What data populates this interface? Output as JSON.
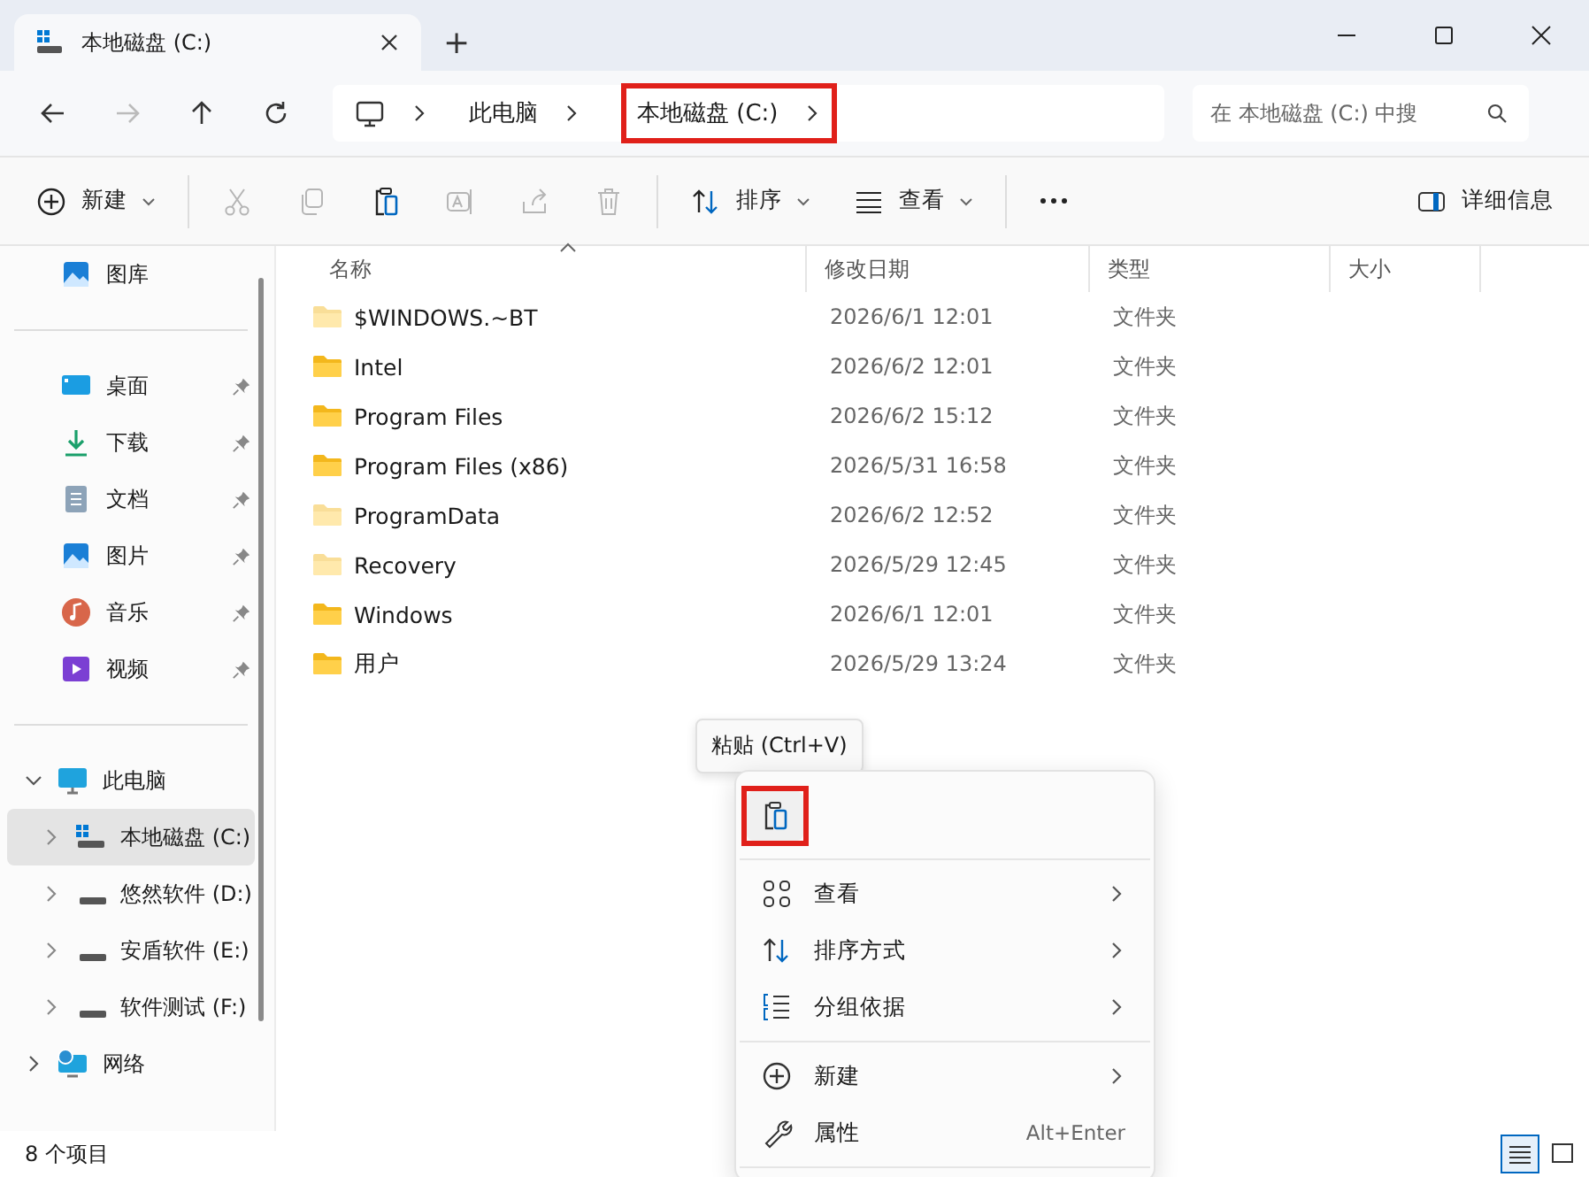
{
  "window": {
    "tab_title": "本地磁盘 (C:)",
    "new_tab": "+"
  },
  "address_bar": {
    "breadcrumbs": [
      {
        "label": "此电脑",
        "highlighted": false
      },
      {
        "label": "本地磁盘 (C:)",
        "highlighted": true
      }
    ]
  },
  "search": {
    "placeholder": "在 本地磁盘 (C:) 中搜"
  },
  "toolbar": {
    "buttons": [
      {
        "kind": "new",
        "label": "新建",
        "dropdown": true,
        "disabled": false
      },
      {
        "kind": "cut",
        "disabled": true
      },
      {
        "kind": "copy",
        "disabled": true
      },
      {
        "kind": "paste",
        "disabled": false
      },
      {
        "kind": "rename",
        "disabled": true
      },
      {
        "kind": "share",
        "disabled": true
      },
      {
        "kind": "delete",
        "disabled": true
      },
      {
        "kind": "sort",
        "label": "排序",
        "dropdown": true,
        "disabled": false
      },
      {
        "kind": "view",
        "label": "查看",
        "dropdown": true,
        "disabled": false
      },
      {
        "kind": "more",
        "disabled": false
      }
    ],
    "details": {
      "label": "详细信息"
    }
  },
  "sidebar": {
    "quick_access": [
      {
        "kind": "gallery",
        "label": "图库",
        "pinned": false
      },
      {
        "kind": "desktop",
        "label": "桌面",
        "pinned": true
      },
      {
        "kind": "download",
        "label": "下载",
        "pinned": true
      },
      {
        "kind": "document",
        "label": "文档",
        "pinned": true
      },
      {
        "kind": "picture",
        "label": "图片",
        "pinned": true
      },
      {
        "kind": "music",
        "label": "音乐",
        "pinned": true
      },
      {
        "kind": "video",
        "label": "视频",
        "pinned": true
      }
    ],
    "tree": [
      {
        "kind": "pc",
        "label": "此电脑",
        "expanded": true,
        "selected": false,
        "children": [
          {
            "kind": "system-drive",
            "label": "本地磁盘 (C:)",
            "expanded": false,
            "selected": true
          },
          {
            "kind": "drive",
            "label": "悠然软件 (D:)",
            "expanded": false,
            "selected": false
          },
          {
            "kind": "drive",
            "label": "安盾软件 (E:)",
            "expanded": false,
            "selected": false
          },
          {
            "kind": "drive",
            "label": "软件测试 (F:)",
            "expanded": false,
            "selected": false
          }
        ]
      },
      {
        "kind": "network",
        "label": "网络",
        "expanded": false,
        "selected": false
      }
    ]
  },
  "table": {
    "columns": [
      "名称",
      "修改日期",
      "类型",
      "大小"
    ],
    "rows": [
      {
        "name": "$WINDOWS.~BT",
        "modified": "2026/6/1 12:01",
        "type": "文件夹",
        "hidden": true
      },
      {
        "name": "Intel",
        "modified": "2026/6/2 12:01",
        "type": "文件夹",
        "hidden": false
      },
      {
        "name": "Program Files",
        "modified": "2026/6/2 15:12",
        "type": "文件夹",
        "hidden": false
      },
      {
        "name": "Program Files (x86)",
        "modified": "2026/5/31 16:58",
        "type": "文件夹",
        "hidden": false
      },
      {
        "name": "ProgramData",
        "modified": "2026/6/2 12:52",
        "type": "文件夹",
        "hidden": true
      },
      {
        "name": "Recovery",
        "modified": "2026/5/29 12:45",
        "type": "文件夹",
        "hidden": true
      },
      {
        "name": "Windows",
        "modified": "2026/6/1 12:01",
        "type": "文件夹",
        "hidden": false
      },
      {
        "name": "用户",
        "modified": "2026/5/29 13:24",
        "type": "文件夹",
        "hidden": false
      }
    ]
  },
  "tooltip": {
    "text": "粘贴 (Ctrl+V)"
  },
  "context_menu": {
    "top_actions": [
      {
        "kind": "paste",
        "highlighted": true
      }
    ],
    "groups": [
      [
        {
          "kind": "view",
          "label": "查看",
          "submenu": true
        },
        {
          "kind": "sort",
          "label": "排序方式",
          "submenu": true
        },
        {
          "kind": "group",
          "label": "分组依据",
          "submenu": true
        }
      ],
      [
        {
          "kind": "new",
          "label": "新建",
          "submenu": true
        },
        {
          "kind": "properties",
          "label": "属性",
          "shortcut": "Alt+Enter",
          "submenu": false
        }
      ]
    ]
  },
  "status_bar": {
    "count": "8 个项目",
    "views": [
      {
        "kind": "details",
        "selected": true
      },
      {
        "kind": "tiles",
        "selected": false
      }
    ]
  }
}
